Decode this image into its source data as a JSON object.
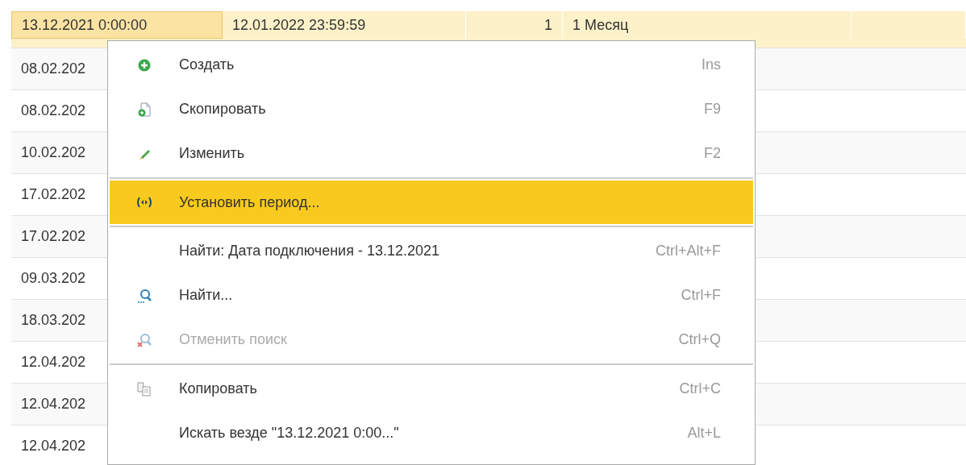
{
  "table": {
    "rows": [
      {
        "selected": true,
        "cells": [
          "13.12.2021 0:00:00",
          "12.01.2022 23:59:59",
          "1",
          "1 Месяц"
        ]
      },
      {
        "selected": false,
        "cells": [
          "08.02.202"
        ]
      },
      {
        "selected": false,
        "cells": [
          "08.02.202"
        ]
      },
      {
        "selected": false,
        "cells": [
          "10.02.202"
        ]
      },
      {
        "selected": false,
        "cells": [
          "17.02.202"
        ]
      },
      {
        "selected": false,
        "cells": [
          "17.02.202"
        ]
      },
      {
        "selected": false,
        "cells": [
          "09.03.202"
        ]
      },
      {
        "selected": false,
        "cells": [
          "18.03.202"
        ]
      },
      {
        "selected": false,
        "cells": [
          "12.04.202"
        ]
      },
      {
        "selected": false,
        "cells": [
          "12.04.202"
        ]
      },
      {
        "selected": false,
        "cells": [
          "12.04.202"
        ]
      }
    ]
  },
  "context_menu": {
    "items": [
      {
        "kind": "command",
        "label": "Создать",
        "shortcut": "Ins",
        "selected": false,
        "disabled": false
      },
      {
        "kind": "command",
        "label": "Скопировать",
        "shortcut": "F9",
        "selected": false,
        "disabled": false
      },
      {
        "kind": "command",
        "label": "Изменить",
        "shortcut": "F2",
        "selected": false,
        "disabled": false
      },
      {
        "kind": "separator"
      },
      {
        "kind": "command",
        "label": "Установить период...",
        "selected": true,
        "disabled": false
      },
      {
        "kind": "separator"
      },
      {
        "kind": "command",
        "label": "Найти: Дата подключения - 13.12.2021",
        "shortcut": "Ctrl+Alt+F",
        "selected": false,
        "disabled": false
      },
      {
        "kind": "command",
        "label": "Найти...",
        "shortcut": "Ctrl+F",
        "selected": false,
        "disabled": false
      },
      {
        "kind": "command",
        "label": "Отменить поиск",
        "shortcut": "Ctrl+Q",
        "selected": false,
        "disabled": true
      },
      {
        "kind": "separator"
      },
      {
        "kind": "command",
        "label": "Копировать",
        "shortcut": "Ctrl+C",
        "selected": false,
        "disabled": false
      },
      {
        "kind": "command",
        "label": "Искать везде \"13.12.2021 0:00...\"",
        "shortcut": "Alt+L",
        "selected": false,
        "disabled": false
      }
    ]
  }
}
